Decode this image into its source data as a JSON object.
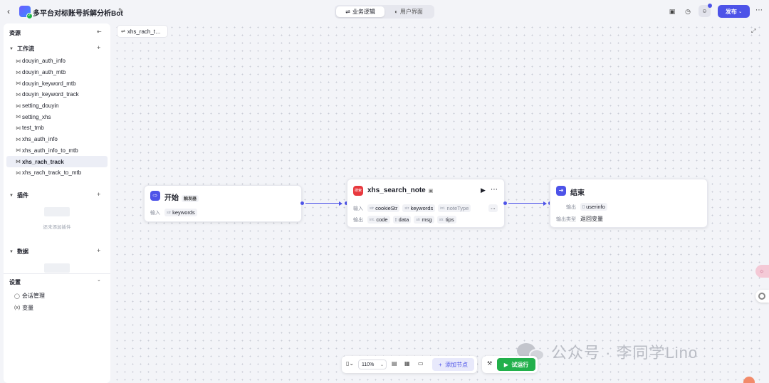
{
  "header": {
    "bot_title": "多平台对标账号拆解分析Bot",
    "tabs": [
      {
        "label": "业务逻辑",
        "active": true
      },
      {
        "label": "用户界面",
        "active": false
      }
    ],
    "publish_label": "发布"
  },
  "sidebar": {
    "title": "资源",
    "sections": {
      "workflow": "工作流",
      "plugin": "插件",
      "data": "数据",
      "settings": "设置"
    },
    "workflows": [
      "douyin_auth_info",
      "douyin_auth_mtb",
      "douyin_keyword_mtb",
      "douyin_keyword_track",
      "setting_douyin",
      "setting_xhs",
      "test_tmb",
      "xhs_auth_info",
      "xhs_auth_info_to_mtb",
      "xhs_rach_track",
      "xhs_rach_track_to_mtb"
    ],
    "active_workflow_index": 9,
    "plugin_empty_text": "还未添加插件",
    "settings_items": [
      "会话管理",
      "变量"
    ]
  },
  "canvas": {
    "tab_label": "xhs_rach_t…",
    "start_node": {
      "title": "开始",
      "badge": "触发器",
      "input_label": "输入",
      "inputs": [
        {
          "type": "str",
          "name": "keywords"
        }
      ]
    },
    "plugin_node": {
      "title": "xhs_search_note",
      "icon_text": "搜索",
      "input_label": "输入",
      "inputs": [
        {
          "type": "str",
          "name": "cookieStr"
        },
        {
          "type": "str",
          "name": "keywords"
        },
        {
          "type": "int.",
          "name": "noteType"
        }
      ],
      "output_label": "输出",
      "outputs": [
        {
          "type": "int.",
          "name": "code"
        },
        {
          "type": "[]",
          "name": "data"
        },
        {
          "type": "str",
          "name": "msg"
        },
        {
          "type": "str.",
          "name": "tips"
        }
      ]
    },
    "end_node": {
      "title": "结束",
      "output_label": "输出",
      "output_var": {
        "type": "[]",
        "name": "userinfo"
      },
      "output_type_label": "输出类型",
      "output_type_value": "返回变量"
    }
  },
  "toolbar": {
    "zoom": "110%",
    "add_node_label": "添加节点",
    "run_label": "试运行"
  },
  "watermark": "公众号 · 李同学Lino",
  "colors": {
    "accent": "#4d53e8",
    "run_green": "#22b04b",
    "plugin_red": "#e8383d"
  }
}
